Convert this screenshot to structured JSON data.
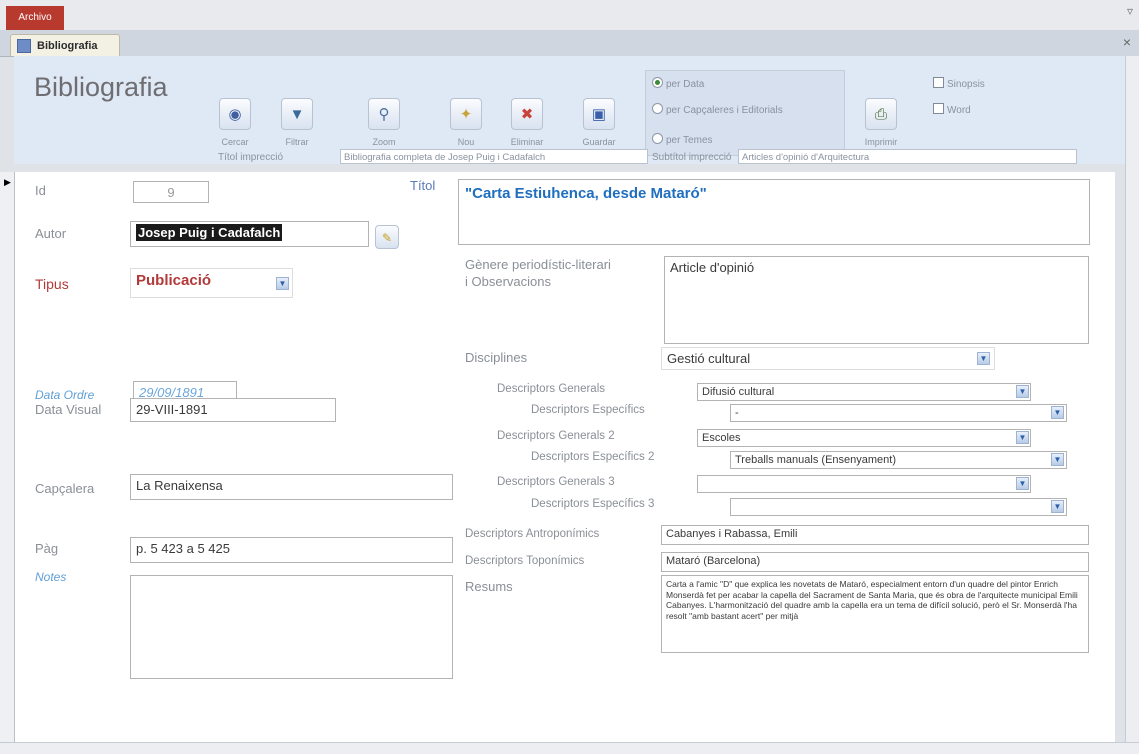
{
  "ribbon": {
    "file_tab": "Archivo",
    "window_control": "▿"
  },
  "document_tab": {
    "label": "Bibliografia",
    "close": "×"
  },
  "header": {
    "title": "Bibliografia",
    "buttons": [
      {
        "label": "Cercar",
        "icon": "binoculars-icon"
      },
      {
        "label": "Filtrar",
        "icon": "filter-icon"
      },
      {
        "label": "Zoom",
        "icon": "zoom-icon"
      },
      {
        "label": "Nou",
        "icon": "new-record-icon"
      },
      {
        "label": "Eliminar",
        "icon": "delete-record-icon"
      },
      {
        "label": "Guardar",
        "icon": "save-icon"
      },
      {
        "label": "Imprimir",
        "icon": "print-icon"
      }
    ],
    "sort_options": [
      "per Data",
      "per Capçaleres i Editorials",
      "per Temes"
    ],
    "checkboxes": [
      "Sinopsis",
      "Word"
    ],
    "print_title_label": "Títol imprессió",
    "print_title_value": "Bibliografia completa de Josep Puig i Cadafalch",
    "print_subtitle_label": "Subtítol imprессió",
    "print_subtitle_value": "Articles d'opinió d'Arquitectura"
  },
  "record": {
    "id_label": "Id",
    "id_value": "9",
    "autor_label": "Autor",
    "autor_value": "Josep Puig i Cadafalch",
    "tipus_label": "Tipus",
    "tipus_value": "Publicació",
    "data_ordre_label": "Data Ordre",
    "data_ordre_value": "29/09/1891",
    "data_visual_label": "Data Visual",
    "data_visual_value": "29-VIII-1891",
    "capcalera_label": "Capçalera",
    "capcalera_value": "La Renaixensa",
    "pag_label": "Pàg",
    "pag_value": "p. 5 423 a 5 425",
    "notes_label": "Notes",
    "notes_value": "",
    "titol_label": "Títol",
    "titol_value": "\"Carta Estiuhenca, desde Mataró\"",
    "genere_label": "Gènere periodístic-literari i Observacions",
    "genere_value": "Article d'opinió",
    "disciplines_label": "Disciplines",
    "disciplines_value": "Gestió cultural",
    "dg1_label": "Descriptors Generals",
    "dg1_value": "Difusió cultural",
    "de1_label": "Descriptors Específics",
    "de1_value": "-",
    "dg2_label": "Descriptors Generals 2",
    "dg2_value": "Escoles",
    "de2_label": "Descriptors Específics 2",
    "de2_value": "Treballs manuals (Ensenyament)",
    "dg3_label": "Descriptors Generals 3",
    "dg3_value": "",
    "de3_label": "Descriptors Específics 3",
    "de3_value": "",
    "antro_label": "Descriptors Antroponímics",
    "antro_value": "Cabanyes i Rabassa, Emili",
    "topo_label": "Descriptors Toponímics",
    "topo_value": "Mataró (Barcelona)",
    "resums_label": "Resums",
    "resums_value": "Carta a l'amic \"D\" que explica les novetats de Mataró, especialment entorn d'un quadre del pintor Enrich Monserdà fet per acabar la capella del Sacrament de Santa Maria, que és obra de l'arquitecte municipal Emili Cabanyes. L'harmonització del quadre amb la capella era un tema de difícil solució, però el Sr. Monserdà l'ha resolt \"amb bastant acert\" per mitjà"
  },
  "colors": {
    "file_tab": "#b83a2e",
    "header_bg": "#dfe8f5",
    "label_red": "#b23a3a",
    "label_blue": "#5f9ed6",
    "title_blue": "#1f6fbf"
  }
}
